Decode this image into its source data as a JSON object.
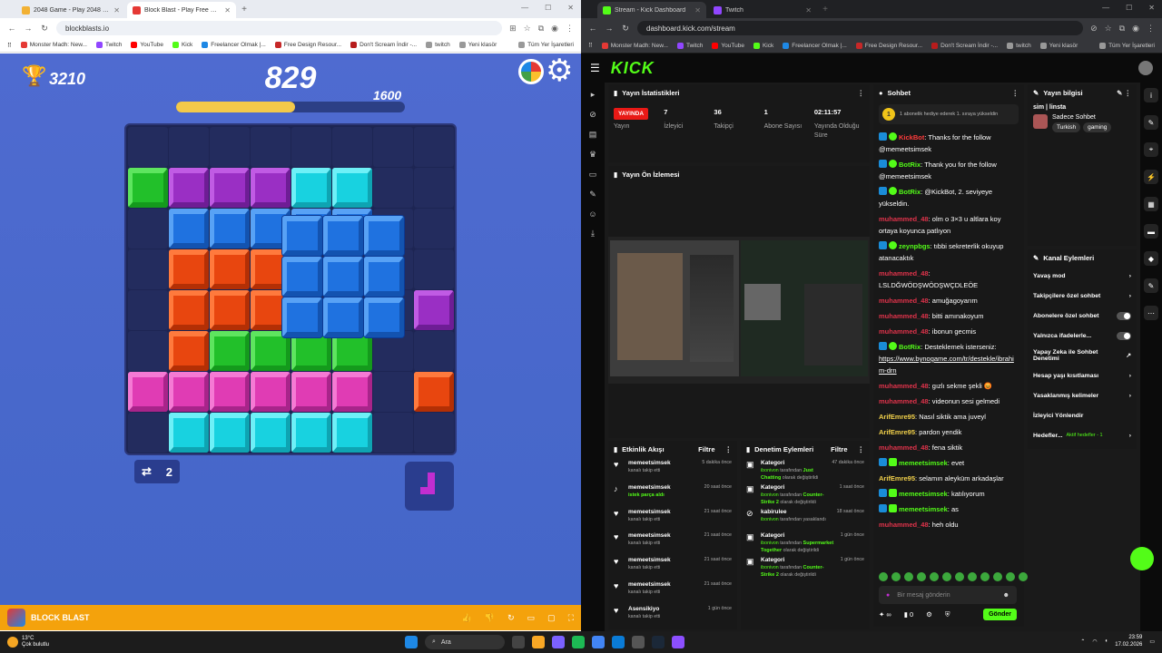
{
  "left_browser": {
    "tabs": [
      {
        "title": "2048 Game - Play 2048 Game O...",
        "color": "#f2b134",
        "active": false
      },
      {
        "title": "Block Blast - Play Free Onli...",
        "color": "#e53935",
        "active": true
      }
    ],
    "url": "blockblasts.io",
    "bookmarks": [
      "Monster Madh: New...",
      "Twitch",
      "YouTube",
      "Kick",
      "Freelancer Olmak |...",
      "Free Design Resour...",
      "Don't Scream İndir -...",
      "twitch",
      "Yeni klasör"
    ],
    "bookmarks_right": "Tüm Yer İşaretleri"
  },
  "game": {
    "best_score": "3210",
    "score": "829",
    "target": "1600",
    "progress": 0.52,
    "swap_count": "2",
    "title": "BLOCK BLAST",
    "next_piece_icon": "purple-piece-icon"
  },
  "right_browser": {
    "tabs": [
      {
        "title": "Stream - Kick Dashboard",
        "color": "#53fc18",
        "active": true
      },
      {
        "title": "Twitch",
        "color": "#9146ff",
        "active": false
      }
    ],
    "url": "dashboard.kick.com/stream",
    "bookmarks": [
      "Monster Madh: New...",
      "Twitch",
      "YouTube",
      "Kick",
      "Freelancer Olmak |...",
      "Free Design Resour...",
      "Don't Scream İndir -...",
      "twitch",
      "Yeni klasör"
    ],
    "bookmarks_right": "Tüm Yer İşaretleri"
  },
  "kick": {
    "logo": "KICK",
    "stats": {
      "title": "Yayın İstatistikleri",
      "live": "YAYINDA",
      "live_label": "Yayın",
      "viewers": "7",
      "viewers_label": "İzleyici",
      "followers": "36",
      "followers_label": "Takipçi",
      "subs": "1",
      "subs_label": "Abone Sayısı",
      "uptime": "02:11:57",
      "uptime_label": "Yayında Olduğu Süre"
    },
    "preview_title": "Yayın Ön İzlemesi",
    "chat": {
      "title": "Sohbet",
      "gift": "1 abonelik hediye ederek 1. sıraya yükseldin",
      "messages": [
        {
          "user": "KickBot",
          "color": "#ff3b3b",
          "text": ": Thanks for the follow @memeetsimsek",
          "badge": "bot"
        },
        {
          "user": "BotRix",
          "color": "#53fc18",
          "text": ": Thank you for the follow @memeetsimsek",
          "badge": "bot"
        },
        {
          "user": "BotRix",
          "color": "#53fc18",
          "text": ": @KickBot, 2. seviyeye yükseldin.",
          "badge": "bot"
        },
        {
          "user": "muhammed_48",
          "color": "#e0334b",
          "text": ": olm o 3×3 u altlara koy ortaya koyunca patlıyon",
          "badge": ""
        },
        {
          "user": "zeynpbgs",
          "color": "#53fc18",
          "text": ": tıbbi sekreterlik okuyup atanacaktık",
          "badge": "bot"
        },
        {
          "user": "muhammed_48",
          "color": "#e0334b",
          "text": ": LSLDĞWÖDŞWÖDŞWÇDLEÖE",
          "badge": ""
        },
        {
          "user": "muhammed_48",
          "color": "#e0334b",
          "text": ": amuğagoyarım",
          "badge": ""
        },
        {
          "user": "muhammed_48",
          "color": "#e0334b",
          "text": ": bitti amınakoyum",
          "badge": ""
        },
        {
          "user": "muhammed_48",
          "color": "#e0334b",
          "text": ": ibonun gecmis",
          "badge": ""
        },
        {
          "user": "BotRix",
          "color": "#53fc18",
          "text": ": Desteklemek isterseniz: ",
          "link": "https://www.bynogame.com/tr/destekle/ibrahim-drn",
          "badge": "bot"
        },
        {
          "user": "muhammed_48",
          "color": "#e0334b",
          "text": ": gızlı sekme şekli 😡",
          "badge": ""
        },
        {
          "user": "muhammed_48",
          "color": "#e0334b",
          "text": ": videonun sesi gelmedi",
          "badge": ""
        },
        {
          "user": "ArifEmre95",
          "color": "#f2d14b",
          "text": ": Nasıl siktik ama juveyl",
          "badge": ""
        },
        {
          "user": "ArifEmre95",
          "color": "#f2d14b",
          "text": ": pardon yendik",
          "badge": ""
        },
        {
          "user": "muhammed_48",
          "color": "#e0334b",
          "text": ": fena siktik",
          "badge": ""
        },
        {
          "user": "memeetsimsek",
          "color": "#53fc18",
          "text": ": evet",
          "badge": "owner"
        },
        {
          "user": "ArifEmre95",
          "color": "#f2d14b",
          "text": ": selamın aleyküm arkadaşlar",
          "badge": ""
        },
        {
          "user": "memeetsimsek",
          "color": "#53fc18",
          "text": ": katılıyorum",
          "badge": "owner"
        },
        {
          "user": "memeetsimsek",
          "color": "#53fc18",
          "text": ": as",
          "badge": "owner"
        },
        {
          "user": "muhammed_48",
          "color": "#e0334b",
          "text": ": heh oldu",
          "badge": ""
        }
      ],
      "input_placeholder": "Bir mesaj gönderin",
      "infinity": "∞",
      "points": "0",
      "send": "Gönder"
    },
    "info": {
      "title": "Yayın bilgisi",
      "stream_title": "sim | linsta",
      "category": "Sadece Sohbet",
      "tags": [
        "Turkish",
        "gaming"
      ]
    },
    "actions": {
      "title": "Kanal Eylemleri",
      "items": [
        {
          "label": "Yavaş mod",
          "type": "arrow"
        },
        {
          "label": "Takipçilere özel sohbet",
          "type": "arrow"
        },
        {
          "label": "Abonelere özel sohbet",
          "type": "toggle"
        },
        {
          "label": "Yalnızca ifadelerle...",
          "type": "toggle"
        },
        {
          "label": "Yapay Zeka ile Sohbet Denetimi",
          "type": "ext"
        },
        {
          "label": "Hesap yaşı kısıtlaması",
          "type": "arrow"
        },
        {
          "label": "Yasaklanmış kelimeler",
          "type": "arrow"
        },
        {
          "label": "İzleyici Yönlendir",
          "type": "none"
        },
        {
          "label": "Hedefler...",
          "type": "arrow",
          "extra": "Aktif hedefler - 1"
        }
      ]
    },
    "events": {
      "title": "Etkinlik Akışı",
      "filter": "Filtre",
      "items": [
        {
          "user": "memeetsimsek",
          "sub": "kanalı takip etti",
          "time": "5 dakika önce"
        },
        {
          "user": "memeetsimsek",
          "sub": "istek parça aldı",
          "time": "20 saat önce",
          "green": true
        },
        {
          "user": "memeetsimsek",
          "sub": "kanalı takip etti",
          "time": "21 saat önce"
        },
        {
          "user": "memeetsimsek",
          "sub": "kanalı takip etti",
          "time": "21 saat önce"
        },
        {
          "user": "memeetsimsek",
          "sub": "kanalı takip etti",
          "time": "21 saat önce"
        },
        {
          "user": "memeetsimsek",
          "sub": "kanalı takip etti",
          "time": "21 saat önce"
        },
        {
          "user": "Asensikiyo",
          "sub": "kanalı takip etti",
          "time": "1 gün önce"
        }
      ]
    },
    "moderation": {
      "title": "Denetim Eylemleri",
      "filter": "Filtre",
      "items": [
        {
          "title": "Kategori",
          "by": "ibonivon",
          "mid": " tarafından ",
          "target": "Just Chatting",
          "end": "olarak değiştirildi",
          "time": "47 dakika önce"
        },
        {
          "title": "Kategori",
          "by": "ibonivon",
          "mid": " tarafından ",
          "target": "Counter-Strike 2",
          "end": "olarak değiştirildi",
          "time": "1 saat önce"
        },
        {
          "title": "kabirulee",
          "by": "ibonivon",
          "mid": " tarafından yasaklandı",
          "target": "",
          "end": "",
          "time": "18 saat önce"
        },
        {
          "title": "Kategori",
          "by": "ibonivon",
          "mid": " tarafından ",
          "target": "Supermarket Together",
          "end": "olarak değiştirildi",
          "time": "1 gün önce"
        },
        {
          "title": "Kategori",
          "by": "ibonivon",
          "mid": " tarafından ",
          "target": "Counter-Strike 2",
          "end": "olarak değiştirildi",
          "time": "1 gün önce"
        }
      ]
    }
  },
  "taskbar": {
    "temp": "13°C",
    "weather": "Çok bulutlu",
    "search": "Ara",
    "time": "23:59",
    "date": "17.02.2026"
  }
}
